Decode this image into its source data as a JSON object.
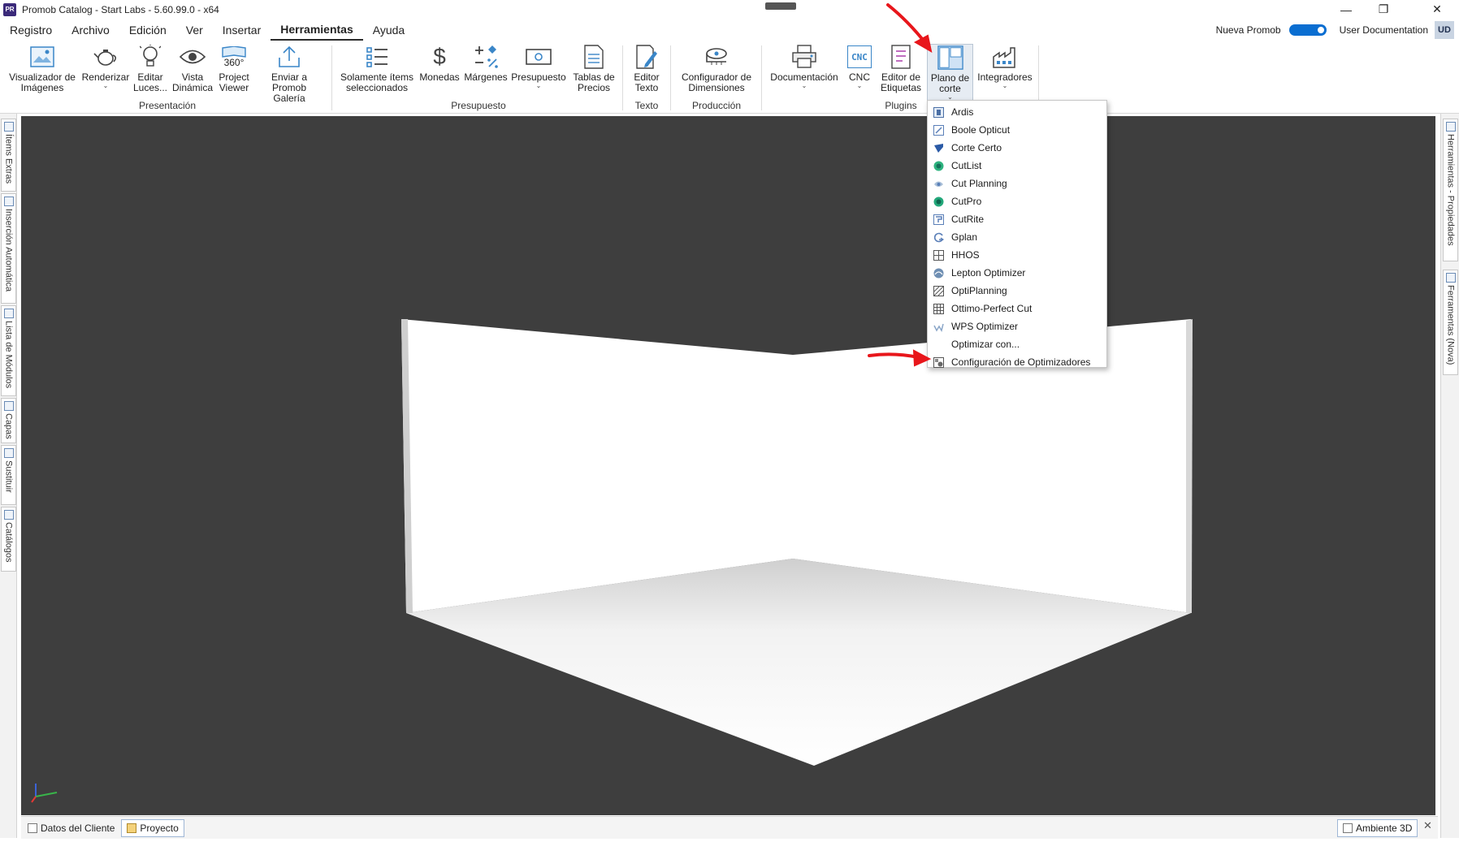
{
  "window": {
    "title": "Promob Catalog - Start Labs - 5.60.99.0 - x64",
    "app_icon_text": "PR"
  },
  "menu": {
    "items": [
      "Registro",
      "Archivo",
      "Edición",
      "Ver",
      "Insertar",
      "Herramientas",
      "Ayuda"
    ],
    "active": "Herramientas",
    "nueva_promob_label": "Nueva Promob",
    "nueva_promob_on": true,
    "user_documentation": "User Documentation",
    "avatar": "UD"
  },
  "ribbon": {
    "groups": [
      "Presentación",
      "Presupuesto",
      "Texto",
      "Producción",
      "Plugins"
    ],
    "buttons": {
      "visualizador": "Visualizador de\nImágenes",
      "renderizar": "Renderizar",
      "editar_luces": "Editar\nLuces...",
      "vista_dinamica": "Vista\nDinámica",
      "project_viewer": "Project\nViewer",
      "project_viewer_icon_text": "360°",
      "enviar_galeria": "Enviar a\nPromob Galería",
      "solamente": "Solamente ítems\nseleccionados",
      "monedas": "Monedas",
      "margenes": "Márgenes",
      "presupuesto": "Presupuesto",
      "tablas_precios": "Tablas de\nPrecios",
      "editor_texto": "Editor\nTexto",
      "configurador_dimensiones": "Configurador de\nDimensiones",
      "documentacion": "Documentación",
      "cnc": "CNC",
      "cnc_icon_text": "CNC",
      "editor_etiquetas": "Editor de\nEtiquetas",
      "plano_corte": "Plano de\ncorte",
      "integradores": "Integradores"
    }
  },
  "dropdown": {
    "items": [
      {
        "label": "Ardis",
        "icon": "ardis-icon"
      },
      {
        "label": "Boole Opticut",
        "icon": "boole-icon"
      },
      {
        "label": "Corte Certo",
        "icon": "corte-certo-icon"
      },
      {
        "label": "CutList",
        "icon": "cutlist-icon"
      },
      {
        "label": "Cut Planning",
        "icon": "cut-planning-icon"
      },
      {
        "label": "CutPro",
        "icon": "cutpro-icon"
      },
      {
        "label": "CutRite",
        "icon": "cutrite-icon"
      },
      {
        "label": "Gplan",
        "icon": "gplan-icon"
      },
      {
        "label": "HHOS",
        "icon": "hhos-icon"
      },
      {
        "label": "Lepton Optimizer",
        "icon": "lepton-icon"
      },
      {
        "label": "OptiPlanning",
        "icon": "optiplanning-icon"
      },
      {
        "label": "Ottimo-Perfect Cut",
        "icon": "ottimo-icon"
      },
      {
        "label": "WPS Optimizer",
        "icon": "wps-icon"
      },
      {
        "label": "Optimizar con...",
        "icon": "none"
      },
      {
        "label": "Configuración de Optimizadores",
        "icon": "config-optimizers-icon"
      }
    ]
  },
  "left_tabs": [
    "Ítems Extras",
    "Inserción Automática",
    "Lista de Módulos",
    "Capas",
    "Sustituir",
    "Catálogos"
  ],
  "right_tabs": [
    "Herramientas - Propiedades",
    "Ferramentas (Nova)"
  ],
  "status": {
    "tabs": [
      "Datos del Cliente",
      "Proyecto"
    ],
    "active": "Proyecto",
    "ambiente": "Ambiente 3D"
  },
  "colors": {
    "viewport_bg": "#3e3e3e",
    "accent": "#0a6ed1",
    "annotation": "#e8161b"
  }
}
